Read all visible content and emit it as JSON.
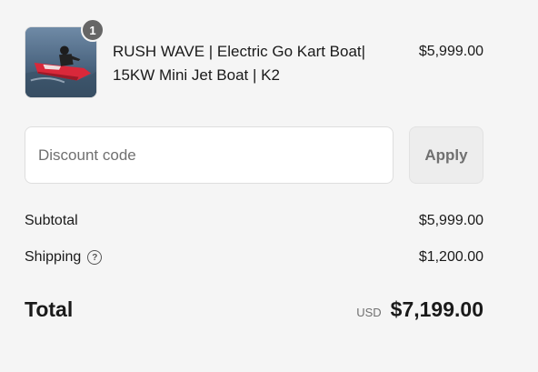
{
  "product": {
    "name_line1": "RUSH WAVE | Electric Go Kart Boat|",
    "name_line2": "15KW Mini Jet Boat | K2",
    "price": "$5,999.00",
    "quantity": "1",
    "image_icon": "jet-boat-photo"
  },
  "discount": {
    "placeholder": "Discount code",
    "value": "",
    "apply_label": "Apply"
  },
  "totals": {
    "subtotal_label": "Subtotal",
    "subtotal_value": "$5,999.00",
    "shipping_label": "Shipping",
    "shipping_help_icon": "question-circle-icon",
    "shipping_value": "$1,200.00",
    "total_label": "Total",
    "currency": "USD",
    "total_value": "$7,199.00"
  },
  "colors": {
    "background": "#f5f5f5",
    "text": "#1a1a1a",
    "muted": "#707070",
    "badge": "#666666"
  }
}
